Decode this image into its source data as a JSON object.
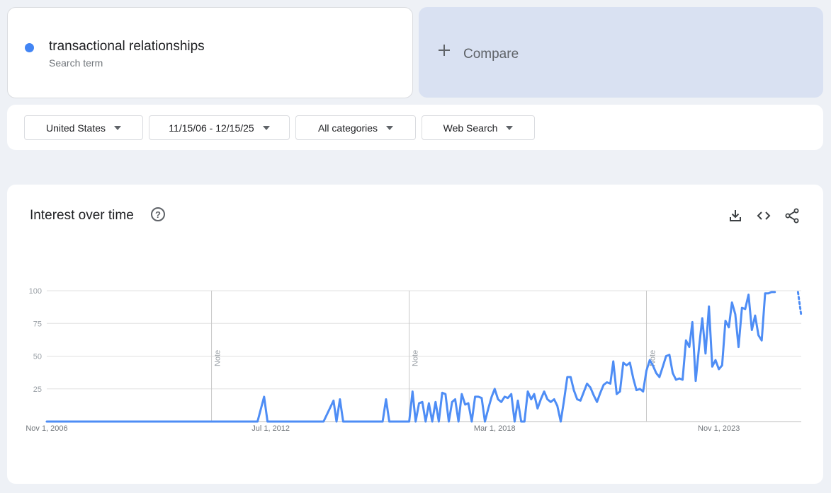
{
  "search_term": {
    "name": "transactional relationships",
    "sub": "Search term",
    "color": "#4285f4"
  },
  "compare": {
    "label": "Compare",
    "icon": "plus-icon"
  },
  "filters": [
    {
      "label": "United States",
      "icon": "caret-down-icon"
    },
    {
      "label": "11/15/06 - 12/15/25",
      "icon": "caret-down-icon"
    },
    {
      "label": "All categories",
      "icon": "caret-down-icon"
    },
    {
      "label": "Web Search",
      "icon": "caret-down-icon"
    }
  ],
  "chart_card": {
    "title": "Interest over time",
    "help_icon": "?",
    "actions": [
      "download-icon",
      "embed-code-icon",
      "share-icon"
    ],
    "note_label": "Note"
  },
  "chart_data": {
    "type": "line",
    "x_range": [
      "2006-11-01",
      "2025-12-01"
    ],
    "ylim": [
      0,
      100
    ],
    "y_ticks": [
      "100",
      "75",
      "50",
      "25"
    ],
    "x_tick_labels": [
      "Nov 1, 2006",
      "Jul 1, 2012",
      "Mar 1, 2018",
      "Nov 1, 2023"
    ],
    "x_tick_dates": [
      "2006-11-01",
      "2012-07-01",
      "2018-03-01",
      "2023-11-01"
    ],
    "note_dates": [
      "2011-01-01",
      "2016-01-01",
      "2022-01-01"
    ],
    "grid": true,
    "line_color": "#4e8df5",
    "series": [
      {
        "dates": [
          "2006-11-01",
          "2011-01-01",
          "2012-03-01",
          "2012-05-01",
          "2012-06-01",
          "2012-07-01",
          "2013-11-01",
          "2014-02-01",
          "2014-03-01",
          "2014-04-01",
          "2014-05-01",
          "2014-06-01",
          "2014-07-01",
          "2014-08-01",
          "2015-05-01",
          "2015-06-01",
          "2015-07-01",
          "2015-08-01",
          "2016-01-01",
          "2016-02-01",
          "2016-03-01",
          "2016-04-01",
          "2016-05-01",
          "2016-06-01",
          "2016-07-01",
          "2016-08-01",
          "2016-09-01",
          "2016-10-01",
          "2016-11-01",
          "2016-12-01",
          "2017-01-01",
          "2017-02-01",
          "2017-03-01",
          "2017-04-01",
          "2017-05-01",
          "2017-06-01",
          "2017-07-01",
          "2017-08-01",
          "2017-09-01",
          "2017-10-01",
          "2017-11-01",
          "2017-12-01",
          "2018-01-01",
          "2018-02-01",
          "2018-03-01",
          "2018-04-01",
          "2018-05-01",
          "2018-06-01",
          "2018-07-01",
          "2018-08-01",
          "2018-09-01",
          "2018-10-01",
          "2018-11-01",
          "2018-12-01",
          "2019-01-01",
          "2019-02-01",
          "2019-03-01",
          "2019-04-01",
          "2019-05-01",
          "2019-06-01",
          "2019-07-01",
          "2019-08-01",
          "2019-09-01",
          "2019-10-01",
          "2019-11-01",
          "2019-12-01",
          "2020-01-01",
          "2020-02-01",
          "2020-03-01",
          "2020-04-01",
          "2020-05-01",
          "2020-07-01",
          "2020-08-01",
          "2020-09-01",
          "2020-10-01",
          "2020-11-01",
          "2020-12-01",
          "2021-01-01",
          "2021-02-01",
          "2021-03-01",
          "2021-04-01",
          "2021-05-01",
          "2021-06-01",
          "2021-07-01",
          "2021-08-01",
          "2021-09-01",
          "2021-10-01",
          "2021-11-01",
          "2021-12-01",
          "2022-01-01",
          "2022-02-01",
          "2022-03-01",
          "2022-04-01",
          "2022-05-01",
          "2022-06-01",
          "2022-07-01",
          "2022-08-01",
          "2022-09-01",
          "2022-10-01",
          "2022-11-01",
          "2022-12-01",
          "2023-01-01",
          "2023-02-01",
          "2023-03-01",
          "2023-04-01",
          "2023-05-01",
          "2023-06-01",
          "2023-07-01",
          "2023-08-01",
          "2023-09-01",
          "2023-10-01",
          "2023-11-01",
          "2023-12-01",
          "2024-01-01",
          "2024-02-01",
          "2024-03-01",
          "2024-04-01",
          "2024-05-01",
          "2024-06-01",
          "2024-07-01",
          "2024-08-01",
          "2024-09-01",
          "2024-10-01",
          "2024-11-01",
          "2024-12-01",
          "2025-01-01",
          "2025-02-01",
          "2025-03-01",
          "2025-04-01",
          "2025-05-01",
          "2025-06-01",
          "2025-07-01",
          "2025-08-01",
          "2025-09-01",
          "2025-10-01",
          "2025-11-01"
        ],
        "values": [
          0,
          0,
          0,
          19,
          0,
          0,
          0,
          16,
          0,
          17,
          0,
          0,
          0,
          0,
          0,
          17,
          0,
          0,
          0,
          23,
          0,
          14,
          15,
          0,
          14,
          0,
          15,
          0,
          22,
          21,
          0,
          15,
          17,
          0,
          21,
          13,
          14,
          0,
          19,
          19,
          18,
          0,
          10,
          19,
          25,
          17,
          15,
          19,
          18,
          21,
          0,
          16,
          0,
          0,
          23,
          17,
          21,
          10,
          17,
          23,
          17,
          15,
          17,
          12,
          0,
          16,
          34,
          34,
          24,
          17,
          16,
          29,
          26,
          20,
          15,
          22,
          28,
          30,
          29,
          46,
          21,
          23,
          45,
          43,
          45,
          33,
          24,
          25,
          23,
          39,
          47,
          43,
          37,
          34,
          42,
          50,
          51,
          37,
          32,
          33,
          32,
          62,
          57,
          76,
          31,
          56,
          79,
          52,
          88,
          42,
          47,
          40,
          43,
          77,
          72,
          91,
          82,
          57,
          87,
          86,
          97,
          70,
          81,
          66,
          62,
          98,
          98,
          99,
          99
        ],
        "partial_values": [
          99,
          81
        ]
      }
    ]
  }
}
